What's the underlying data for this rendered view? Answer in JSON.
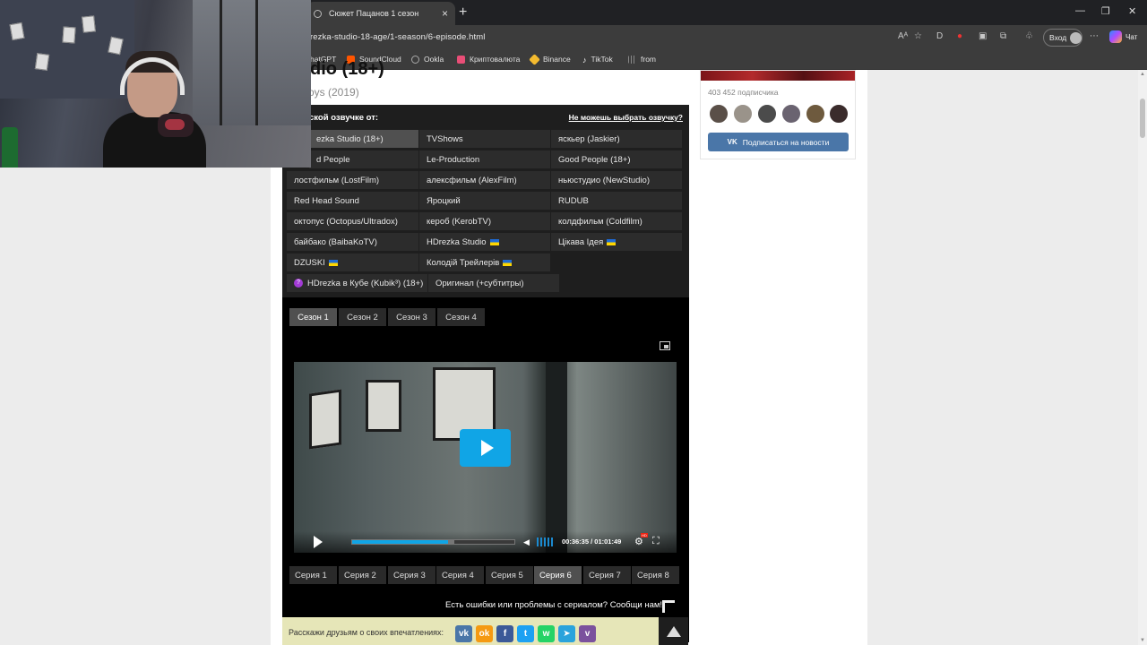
{
  "browser": {
    "tab_title": "Сюжет Пацанов 1 сезон",
    "url": "rezka-studio-18-age/1-season/6-episode.html",
    "login_label": "Вход",
    "chat_label": "Чат",
    "bookmarks": [
      {
        "label": "hatGPT",
        "color": "#4caf50"
      },
      {
        "label": "SoundCloud",
        "color": "#ff5500"
      },
      {
        "label": "Ookla",
        "color": "#9aa0a6"
      },
      {
        "label": "Криптовалюта",
        "color": "#e94e77"
      },
      {
        "label": "Binance",
        "color": "#f3ba2f"
      },
      {
        "label": "TikTok",
        "color": "#ffffff"
      },
      {
        "label": "from",
        "color": "#9aa0a6"
      }
    ]
  },
  "page": {
    "title": "dio (18+)",
    "original_title": "oys (2019)",
    "translations_label": "ской озвучке от:",
    "translations_help": "Не можешь выбрать озвучку?",
    "translations": [
      [
        "ezka Studio (18+)",
        "TVShows",
        "яскьер (Jaskier)"
      ],
      [
        "d People",
        "Le-Production",
        "Good People (18+)"
      ],
      [
        "лостфильм (LostFilm)",
        "алексфильм (AlexFilm)",
        "ньюстудио (NewStudio)"
      ],
      [
        "Red Head Sound",
        "Яроцкий",
        "RUDUB"
      ],
      [
        "октопус (Octopus/Ultradox)",
        "кероб (KerobTV)",
        "колдфильм (Coldfilm)"
      ],
      [
        "байбако (BaibaKoTV)",
        "HDrezka Studio",
        "Цікава Ідея"
      ],
      [
        "DZUSKI",
        "Колодій Трейлерів"
      ]
    ],
    "kubik_label": "HDrezka в Кубе (Kubik³) (18+)",
    "original_subs_label": "Оригинал (+субтитры)",
    "seasons": [
      "Сезон 1",
      "Сезон 2",
      "Сезон 3",
      "Сезон 4"
    ],
    "active_season": 0,
    "player": {
      "time_current": "00:36:35",
      "time_total": "01:01:49",
      "progress": 0.592,
      "buffered": 0.63
    },
    "episodes": [
      "Серия 1",
      "Серия 2",
      "Серия 3",
      "Серия 4",
      "Серия 5",
      "Серия 6",
      "Серия 7",
      "Серия 8"
    ],
    "active_episode": 5,
    "report_text": "Есть ошибки или проблемы с сериалом? Сообщи нам!",
    "share_label": "Расскажи друзьям о своих впечатлениях:",
    "share_buttons": [
      {
        "icon": "vk-icon",
        "glyph": "vk",
        "color": "#4a76a8"
      },
      {
        "icon": "odnoklassniki-icon",
        "glyph": "ok",
        "color": "#f59a12"
      },
      {
        "icon": "facebook-icon",
        "glyph": "f",
        "color": "#3b5998"
      },
      {
        "icon": "twitter-icon",
        "glyph": "t",
        "color": "#1da1f2"
      },
      {
        "icon": "whatsapp-icon",
        "glyph": "w",
        "color": "#25d366"
      },
      {
        "icon": "telegram-icon",
        "glyph": "➤",
        "color": "#2aa3dc"
      },
      {
        "icon": "viber-icon",
        "glyph": "v",
        "color": "#7b519d"
      }
    ]
  },
  "widget": {
    "subscribers": "403 452 подписчика",
    "subscribe_label": "Подписаться на новости",
    "vk_glyph": "VK"
  }
}
